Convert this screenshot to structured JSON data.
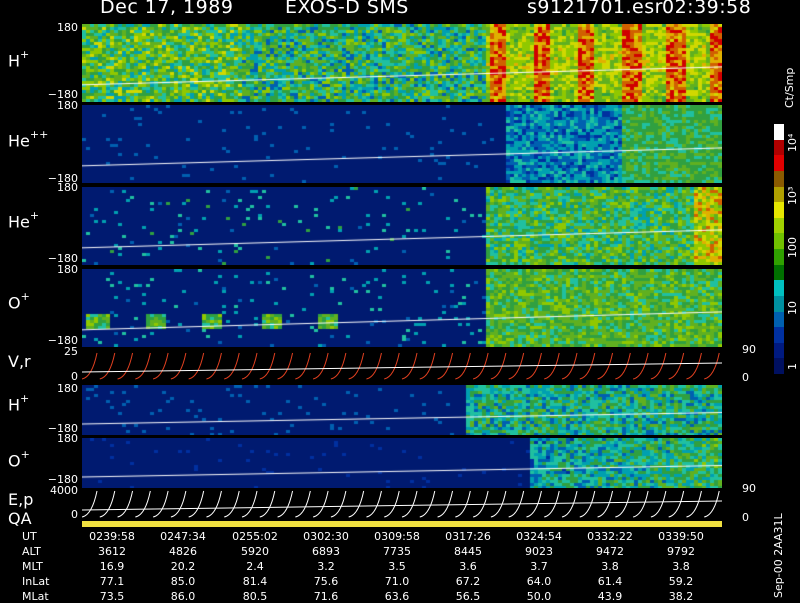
{
  "header": {
    "date": "Dec 17, 1989",
    "instrument": "EXOS-D SMS",
    "file": "s9121701.esr",
    "time": "02:39:58"
  },
  "panels": [
    {
      "label": "H",
      "charge": "+",
      "top_tick": "180",
      "bot_tick": "−180"
    },
    {
      "label": "He",
      "charge": "++",
      "top_tick": "180",
      "bot_tick": "−180"
    },
    {
      "label": "He",
      "charge": "+",
      "top_tick": "180",
      "bot_tick": "−180"
    },
    {
      "label": "O",
      "charge": "+",
      "top_tick": "180",
      "bot_tick": "−180"
    },
    {
      "label": "V,r",
      "charge": "",
      "top_tick": "25",
      "bot_tick": "0",
      "right_top": "90",
      "right_bot": "0"
    },
    {
      "label": "H",
      "charge": "+",
      "top_tick": "180",
      "bot_tick": "−180"
    },
    {
      "label": "O",
      "charge": "+",
      "top_tick": "180",
      "bot_tick": "−180"
    },
    {
      "label": "E,p",
      "charge": "",
      "top_tick": "4000",
      "bot_tick": "0",
      "right_top": "90",
      "right_bot": "0"
    }
  ],
  "qa_label": "QA",
  "colorbar": {
    "units": "Ct/Smp",
    "ticks": [
      "10⁴",
      "10³",
      "100",
      "10",
      "1"
    ]
  },
  "footer": {
    "rows": [
      {
        "label": "UT",
        "values": [
          "0239:58",
          "0247:34",
          "0255:02",
          "0302:30",
          "0309:58",
          "0317:26",
          "0324:54",
          "0332:22",
          "0339:50"
        ]
      },
      {
        "label": "ALT",
        "values": [
          "3612",
          "4826",
          "5920",
          "6893",
          "7735",
          "8445",
          "9023",
          "9472",
          "9792"
        ]
      },
      {
        "label": "MLT",
        "values": [
          "16.9",
          "20.2",
          "2.4",
          "3.2",
          "3.5",
          "3.6",
          "3.7",
          "3.8",
          "3.8"
        ]
      },
      {
        "label": "InLat",
        "values": [
          "77.1",
          "85.0",
          "81.4",
          "75.6",
          "71.0",
          "67.2",
          "64.0",
          "61.4",
          "59.2"
        ]
      },
      {
        "label": "MLat",
        "values": [
          "73.5",
          "86.0",
          "80.5",
          "71.6",
          "63.6",
          "56.5",
          "50.0",
          "43.9",
          "38.2"
        ]
      }
    ],
    "side_note": "Sep-00 2AA31L"
  },
  "chart_data": {
    "type": "heatmap",
    "title": "Dec 17, 1989   EXOS-D SMS",
    "x": [
      "0239:58",
      "0247:34",
      "0255:02",
      "0302:30",
      "0309:58",
      "0317:26",
      "0324:54",
      "0332:22",
      "0339:50"
    ],
    "series": [
      {
        "name": "H+",
        "ylim": [
          -180,
          180
        ]
      },
      {
        "name": "He++",
        "ylim": [
          -180,
          180
        ]
      },
      {
        "name": "He+",
        "ylim": [
          -180,
          180
        ]
      },
      {
        "name": "O+",
        "ylim": [
          -180,
          180
        ]
      },
      {
        "name": "V,r",
        "ylim": [
          0,
          25
        ]
      },
      {
        "name": "H+",
        "ylim": [
          -180,
          180
        ]
      },
      {
        "name": "O+",
        "ylim": [
          -180,
          180
        ]
      },
      {
        "name": "E,p",
        "ylim": [
          0,
          4000
        ]
      }
    ],
    "colorbar_label": "Ct/Smp",
    "colorbar_range": [
      1,
      10000
    ]
  }
}
